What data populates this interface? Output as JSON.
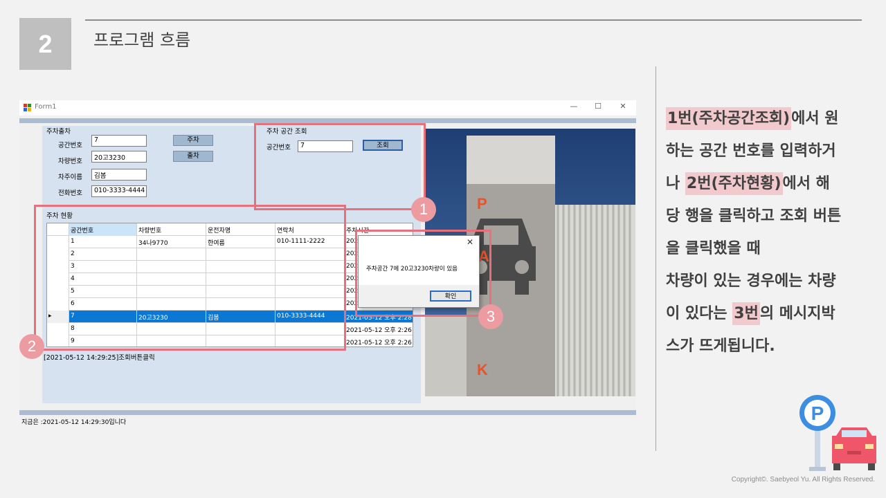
{
  "section": {
    "number": "2",
    "title": "프로그램 흐름"
  },
  "window": {
    "title": "Form1",
    "minimize": "—",
    "maximize": "☐",
    "close": "✕",
    "status_text": "지금은 :2021-05-12 14:29:30입니다"
  },
  "parking_form": {
    "group_title": "주차출차",
    "space_label": "공간번호",
    "space_value": "7",
    "car_label": "차량번호",
    "car_value": "20고3230",
    "owner_label": "차주이름",
    "owner_value": "김봄",
    "phone_label": "전화번호",
    "phone_value": "010-3333-4444",
    "park_button": "주차",
    "exit_button": "출차"
  },
  "lookup": {
    "group_title": "주차 공간 조회",
    "space_label": "공간번호",
    "space_value": "7",
    "lookup_button": "조회"
  },
  "status_grid": {
    "group_title": "주차 현황",
    "columns": [
      "공간번호",
      "차량번호",
      "운전자명",
      "연락처",
      "주차시간"
    ],
    "rows": [
      [
        "1",
        "34나9770",
        "한여름",
        "010-1111-2222",
        "2021"
      ],
      [
        "2",
        "",
        "",
        "",
        "2021"
      ],
      [
        "3",
        "",
        "",
        "",
        "2021"
      ],
      [
        "4",
        "",
        "",
        "",
        "2021"
      ],
      [
        "5",
        "",
        "",
        "",
        "2021"
      ],
      [
        "6",
        "",
        "",
        "",
        "2021"
      ],
      [
        "7",
        "20고3230",
        "김봄",
        "010-3333-4444",
        "2021-05-12 오후 2:28"
      ],
      [
        "8",
        "",
        "",
        "",
        "2021-05-12 오후 2:26"
      ],
      [
        "9",
        "",
        "",
        "",
        "2021-05-12 오후 2:26"
      ]
    ],
    "selected_marker": "▸"
  },
  "log_text": "[2021-05-12 14:29:25]조회버튼클릭",
  "dialog": {
    "message": "주차공간 7에 20고3230차량이 있음",
    "ok_button": "확인",
    "close": "✕"
  },
  "badges": [
    "1",
    "2",
    "3"
  ],
  "photo_letters": [
    "P",
    "A",
    "K"
  ],
  "description": {
    "line1_mark": "1번(주차공간조회)",
    "line1_rest": "에서 원",
    "line2": "하는 공간 번호를 입력하거",
    "line3_pre": "나 ",
    "line3_mark": "2번(주차현황)",
    "line3_rest": "에서 해",
    "line4": "당 행을 클릭하고 조회 버튼",
    "line5": "을 클릭했을 때",
    "line6": "차량이 있는 경우에는 차량",
    "line7_pre": "이 있다는 ",
    "line7_mark": "3번",
    "line7_rest": "의 메시지박",
    "line8": "스가 뜨게됩니다."
  },
  "copyright": "Copyright©. Saebyeol Yu. All Rights Reserved.",
  "colors": {
    "highlight": "#e8707a",
    "badge": "#ec9ba0",
    "selected_row": "#0a78d4",
    "panel": "#d6e2ef"
  }
}
